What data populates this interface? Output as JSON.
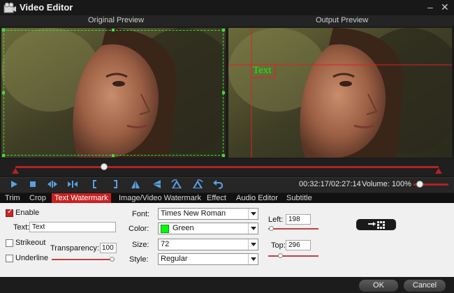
{
  "window": {
    "title": "Video Editor",
    "minimize_glyph": "–",
    "close_glyph": "✕"
  },
  "preview": {
    "original_label": "Original Preview",
    "output_label": "Output Preview"
  },
  "watermark_overlay": {
    "text": "Text",
    "color": "#00ff00"
  },
  "playback": {
    "time": "00:32:17/02:27:14",
    "volume_label": "Volume:",
    "volume_value": "100%",
    "volume_level": 0.18,
    "position_fraction": 0.21
  },
  "controls": [
    "play-icon",
    "stop-icon",
    "previous-frame-icon",
    "next-frame-icon",
    "mark-in-icon",
    "mark-out-icon",
    "flip-vertical-icon",
    "flip-horizontal-icon",
    "rotate-left-icon",
    "rotate-right-icon",
    "undo-icon"
  ],
  "tabs": [
    {
      "label": "Trim",
      "active": false
    },
    {
      "label": "Crop",
      "active": false
    },
    {
      "label": "Text Watermark",
      "active": true
    },
    {
      "label": "Image/Video Watermark",
      "active": false
    },
    {
      "label": "Effect",
      "active": false
    },
    {
      "label": "Audio Editor",
      "active": false
    },
    {
      "label": "Subtitle",
      "active": false
    }
  ],
  "text_watermark": {
    "enable_label": "Enable",
    "enable_checked": true,
    "text_label": "Text:",
    "text_value": "Text",
    "strikeout_label": "Strikeout",
    "strikeout_checked": false,
    "underline_label": "Underline",
    "underline_checked": false,
    "transparency_label": "Transparency:",
    "transparency_value": "100",
    "font_label": "Font:",
    "font_value": "Times New Roman",
    "color_label": "Color:",
    "color_value": "Green",
    "color_hex": "#00ff00",
    "size_label": "Size:",
    "size_value": "72",
    "style_label": "Style:",
    "style_value": "Regular",
    "left_label": "Left:",
    "left_value": "198",
    "top_label": "Top:",
    "top_value": "296"
  },
  "buttons": {
    "ok": "OK",
    "cancel": "Cancel"
  },
  "colors": {
    "accent": "#c92020",
    "crop_guide": "#3ddc3d",
    "watermark_guide": "#e02020"
  }
}
